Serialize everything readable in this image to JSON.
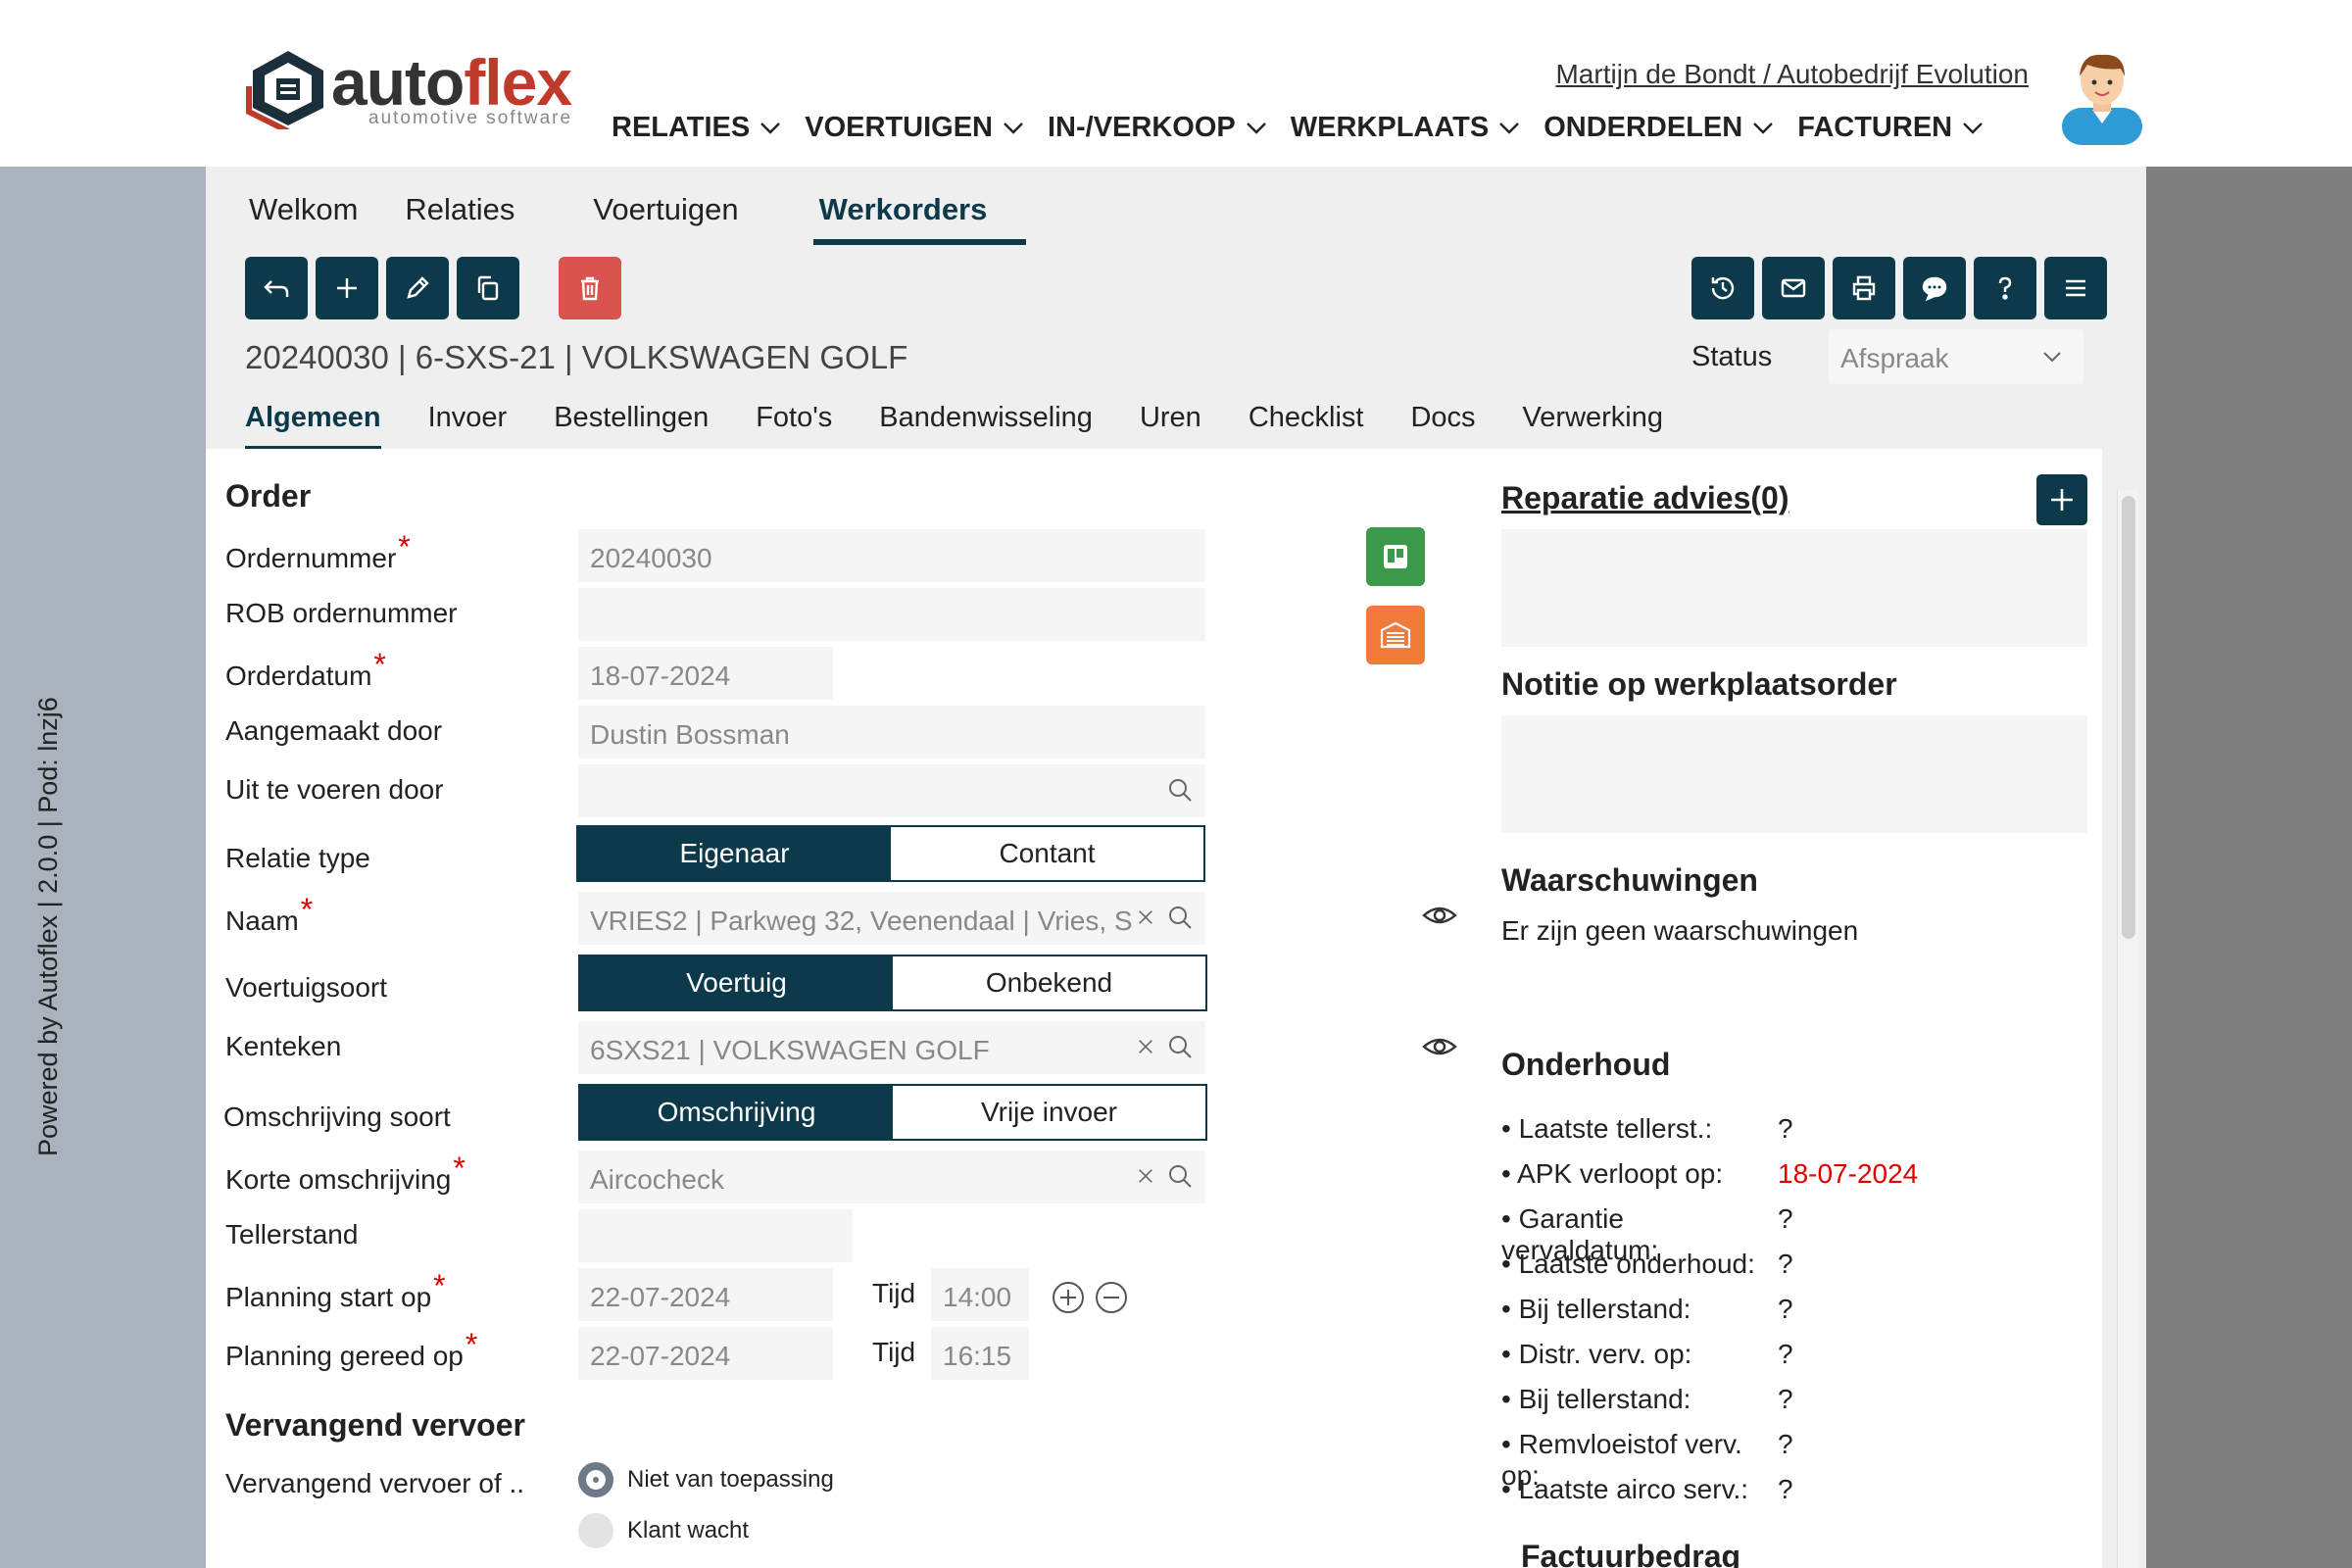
{
  "brand": {
    "name_part1": "auto",
    "name_part2": "flex",
    "tagline": "automotive software"
  },
  "user": {
    "link": "Martijn de Bondt / Autobedrijf Evolution"
  },
  "mainnav": [
    {
      "label": "RELATIES"
    },
    {
      "label": "VOERTUIGEN"
    },
    {
      "label": "IN-/VERKOOP"
    },
    {
      "label": "WERKPLAATS"
    },
    {
      "label": "ONDERDELEN"
    },
    {
      "label": "FACTUREN"
    }
  ],
  "sidebar": {
    "powered": "Powered by Autoflex | 2.0.0 | Pod: lnzj6"
  },
  "tabs": [
    "Welkom",
    "Relaties",
    "Voertuigen",
    "Werkorders"
  ],
  "workorder": {
    "title": "20240030 | 6-SXS-21 | VOLKSWAGEN GOLF",
    "status_label": "Status",
    "status_value": "Afspraak"
  },
  "subtabs": [
    "Algemeen",
    "Invoer",
    "Bestellingen",
    "Foto's",
    "Bandenwisseling",
    "Uren",
    "Checklist",
    "Docs",
    "Verwerking"
  ],
  "order": {
    "heading": "Order",
    "ordernummer_label": "Ordernummer",
    "ordernummer": "20240030",
    "rob_label": "ROB ordernummer",
    "rob": "",
    "orderdatum_label": "Orderdatum",
    "orderdatum": "18-07-2024",
    "aangemaakt_label": "Aangemaakt door",
    "aangemaakt": "Dustin Bossman",
    "uitvoeren_label": "Uit te voeren door",
    "uitvoeren": "",
    "relatietype_label": "Relatie type",
    "relatietype_opt1": "Eigenaar",
    "relatietype_opt2": "Contant",
    "naam_label": "Naam",
    "naam": "VRIES2  | Parkweg 32, Veenendaal | Vries, S",
    "voertuigsoort_label": "Voertuigsoort",
    "voertuigsoort_opt1": "Voertuig",
    "voertuigsoort_opt2": "Onbekend",
    "kenteken_label": "Kenteken",
    "kenteken": "6SXS21 | VOLKSWAGEN GOLF",
    "omschrsoort_label": "Omschrijving soort",
    "omschrsoort_opt1": "Omschrijving",
    "omschrsoort_opt2": "Vrije invoer",
    "korte_label": "Korte omschrijving",
    "korte": "Aircocheck",
    "tellerstand_label": "Tellerstand",
    "tellerstand": "",
    "pstart_label": "Planning start op",
    "pstart": "22-07-2024",
    "tijd_label": "Tijd",
    "pstart_tijd": "14:00",
    "pgereed_label": "Planning gereed op",
    "pgereed": "22-07-2024",
    "pgereed_tijd": "16:15"
  },
  "vervangend": {
    "heading": "Vervangend vervoer",
    "label": "Vervangend vervoer of ..",
    "opt1": "Niet van toepassing",
    "opt2": "Klant wacht"
  },
  "right": {
    "advies": "Reparatie advies(0)",
    "notitie": "Notitie op werkplaatsorder",
    "waarschuwingen": "Waarschuwingen",
    "geen": "Er zijn geen waarschuwingen",
    "onderhoud": "Onderhoud",
    "rows": [
      {
        "k": "• Laatste tellerst.:",
        "v": "?"
      },
      {
        "k": "• APK verloopt op:",
        "v": "18-07-2024"
      },
      {
        "k": "• Garantie vervaldatum:",
        "v": "?"
      },
      {
        "k": "• Laatste onderhoud:",
        "v": "?"
      },
      {
        "k": "• Bij tellerstand:",
        "v": "?"
      },
      {
        "k": "• Distr. verv. op:",
        "v": "?"
      },
      {
        "k": "• Bij tellerstand:",
        "v": "?"
      },
      {
        "k": "• Remvloeistof verv. op:",
        "v": "?"
      },
      {
        "k": "• Laatste airco serv.:",
        "v": "?"
      }
    ],
    "factuur": "Factuurbedrag"
  },
  "colors": {
    "primary": "#0d3a4a",
    "danger": "#d9534f",
    "green": "#3a9a4a",
    "orange": "#f07a3a"
  }
}
